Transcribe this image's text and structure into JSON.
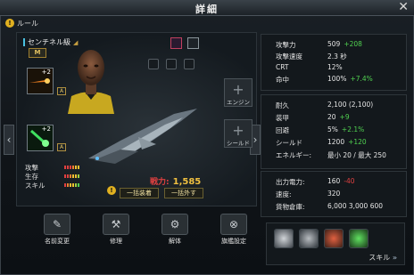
{
  "window": {
    "title": "詳細",
    "close": "✕"
  },
  "rule": {
    "label": "ルール",
    "icon": "info-icon"
  },
  "ship": {
    "name": "センチネル級",
    "rank": "M"
  },
  "modules": {
    "engine": "エンジン",
    "shield": "シールド"
  },
  "slots": [
    {
      "plus": "+2",
      "grade": "A"
    },
    {
      "plus": "+2",
      "grade": "A"
    }
  ],
  "stats_bars": [
    {
      "label": "攻撃",
      "colors": [
        "#e04040",
        "#e04040",
        "#e04040",
        "#f08030",
        "#f0c030",
        "#f0c030"
      ]
    },
    {
      "label": "生存",
      "colors": [
        "#e04040",
        "#e04040",
        "#f08030",
        "#f0c030",
        "#f0c030",
        "#a0d040"
      ]
    },
    {
      "label": "スキル",
      "colors": [
        "#e04040",
        "#f08030",
        "#f0c030",
        "#f0c030",
        "#a0d040",
        "#50d050"
      ]
    }
  ],
  "power": {
    "label": "戦力:",
    "value": "1,585"
  },
  "buttons": {
    "equip_all": "一括装着",
    "remove_all": "一括外す"
  },
  "actions": [
    {
      "label": "名前変更",
      "icon": "rename-icon"
    },
    {
      "label": "修理",
      "icon": "repair-icon"
    },
    {
      "label": "解体",
      "icon": "dismantle-icon"
    },
    {
      "label": "旗艦設定",
      "icon": "flagship-icon"
    }
  ],
  "attack": [
    {
      "k": "攻撃力",
      "v": "509",
      "delta": "+208",
      "color": "green"
    },
    {
      "k": "攻撃速度",
      "v": "2.3 秒",
      "delta": "",
      "color": ""
    },
    {
      "k": "CRT",
      "v": "12%",
      "delta": "",
      "color": ""
    },
    {
      "k": "命中",
      "v": "100%",
      "delta": "+7.4%",
      "color": "green"
    }
  ],
  "defense": [
    {
      "k": "耐久",
      "v": "2,100 (2,100)",
      "delta": "",
      "color": ""
    },
    {
      "k": "装甲",
      "v": "20",
      "delta": "+9",
      "color": "green"
    },
    {
      "k": "回避",
      "v": "5%",
      "delta": "+2.1%",
      "color": "green"
    },
    {
      "k": "シールド",
      "v": "1200",
      "delta": "+120",
      "color": "green"
    },
    {
      "k": "エネルギー:",
      "v": "最小 20 / 最大 250",
      "delta": "",
      "color": ""
    }
  ],
  "output": [
    {
      "k": "出力電力:",
      "v": "160",
      "delta": "-40",
      "color": "red"
    },
    {
      "k": "速度:",
      "v": "320",
      "delta": "",
      "color": ""
    },
    {
      "k": "貨物倉庫:",
      "v": "6,000  3,000  600",
      "delta": "",
      "color": ""
    }
  ],
  "skills": {
    "label": "スキル",
    "chevrons": "»"
  }
}
